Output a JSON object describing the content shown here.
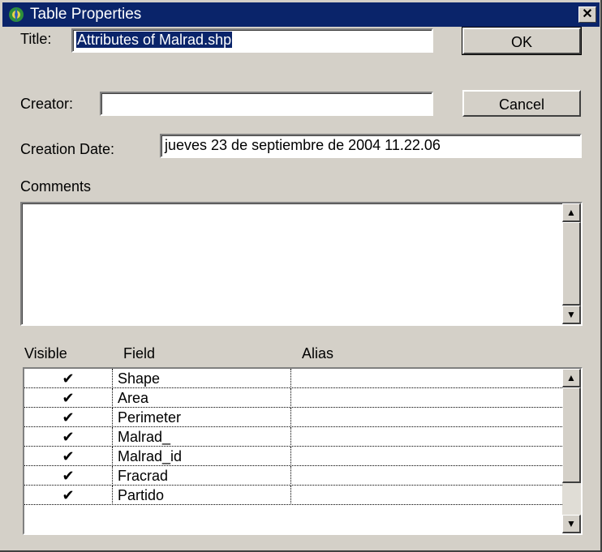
{
  "window": {
    "title": "Table Properties",
    "close_label": "✕"
  },
  "form": {
    "title_label": "Title:",
    "title_value": "Attributes of Malrad.shp",
    "creator_label": "Creator:",
    "creator_value": "",
    "creation_date_label": "Creation Date:",
    "creation_date_value": "jueves 23 de septiembre de 2004 11.22.06",
    "comments_label": "Comments",
    "comments_value": ""
  },
  "buttons": {
    "ok": "OK",
    "cancel": "Cancel"
  },
  "fields_table": {
    "headers": {
      "visible": "Visible",
      "field": "Field",
      "alias": "Alias"
    },
    "rows": [
      {
        "visible": "✔",
        "field": "Shape",
        "alias": ""
      },
      {
        "visible": "✔",
        "field": "Area",
        "alias": ""
      },
      {
        "visible": "✔",
        "field": "Perimeter",
        "alias": ""
      },
      {
        "visible": "✔",
        "field": "Malrad_",
        "alias": ""
      },
      {
        "visible": "✔",
        "field": "Malrad_id",
        "alias": ""
      },
      {
        "visible": "✔",
        "field": "Fracrad",
        "alias": ""
      },
      {
        "visible": "✔",
        "field": "Partido",
        "alias": ""
      }
    ]
  },
  "icons": {
    "app": "table-properties-icon",
    "scroll_up": "▲",
    "scroll_down": "▼"
  }
}
